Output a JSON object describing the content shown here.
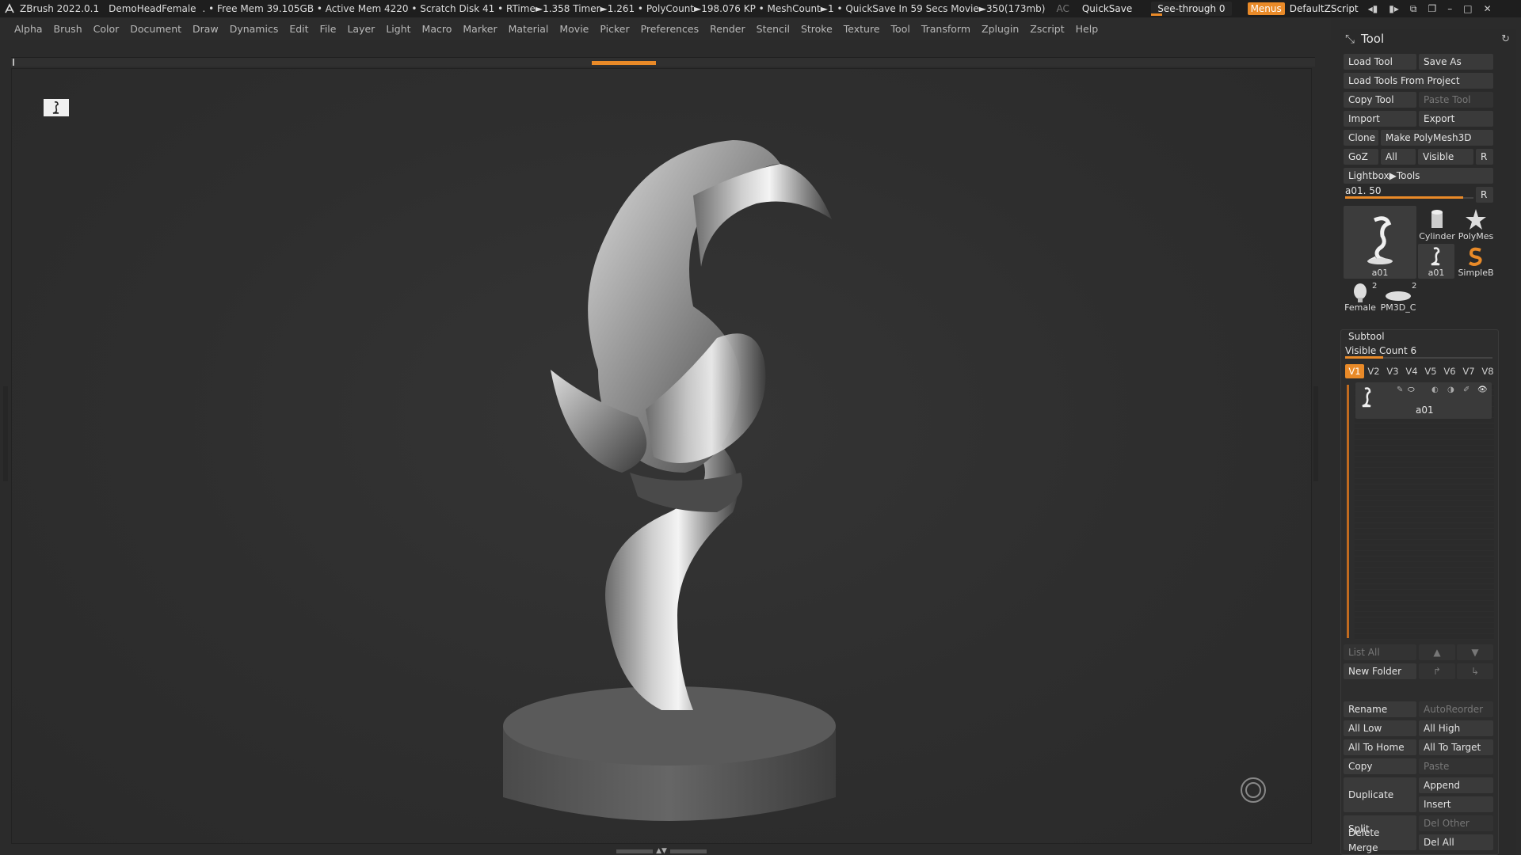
{
  "titlebar": {
    "app": "ZBrush 2022.0.1",
    "project": "DemoHeadFemale",
    "stats": ". • Free Mem 39.105GB • Active Mem 4220 • Scratch Disk 41 • RTime►1.358 Timer►1.261 • PolyCount►198.076 KP • MeshCount►1 • QuickSave In 59 Secs Movie►350(173mb)",
    "ac": "AC",
    "quicksave": "QuickSave",
    "seethrough": "See-through  0",
    "seethrough_value": 0,
    "menus": "Menus",
    "default_zscript": "DefaultZScript",
    "icons": [
      "prev-layout-icon",
      "next-layout-icon",
      "restore-icon",
      "window-icon",
      "minimize-icon",
      "maximize-icon",
      "close-icon"
    ]
  },
  "menubar": [
    "Alpha",
    "Brush",
    "Color",
    "Document",
    "Draw",
    "Dynamics",
    "Edit",
    "File",
    "Layer",
    "Light",
    "Macro",
    "Marker",
    "Material",
    "Movie",
    "Picker",
    "Preferences",
    "Render",
    "Stencil",
    "Stroke",
    "Texture",
    "Tool",
    "Transform",
    "Zplugin",
    "Zscript",
    "Help"
  ],
  "tool_panel": {
    "title": "Tool",
    "buttons": {
      "load_tool": "Load Tool",
      "save_as": "Save As",
      "load_from_project": "Load Tools From Project",
      "copy_tool": "Copy Tool",
      "paste_tool": "Paste Tool",
      "import": "Import",
      "export": "Export",
      "clone": "Clone",
      "make_polymesh": "Make PolyMesh3D",
      "goz": "GoZ",
      "all": "All",
      "visible": "Visible",
      "r": "R",
      "lightbox_tools": "Lightbox▶Tools"
    },
    "slider": {
      "label": "a01. 50",
      "r": "R",
      "fraction": 0.92
    },
    "thumbs": {
      "main": "a01",
      "cylinder": "Cylinder",
      "polymesh": "PolyMes",
      "a01_small": "a01",
      "simpleb": "SimpleB",
      "female": "Female",
      "female_count": "2",
      "pm3d": "PM3D_C",
      "pm3d_count": "2"
    }
  },
  "subtool_panel": {
    "title": "Subtool",
    "visible_count": "Visible Count 6",
    "visible_count_fraction": 0.26,
    "vtabs": [
      "V1",
      "V2",
      "V3",
      "V4",
      "V5",
      "V6",
      "V7",
      "V8"
    ],
    "item_name": "a01",
    "list_all": "List All",
    "new_folder": "New Folder",
    "rename": "Rename",
    "auto_reorder": "AutoReorder",
    "all_low": "All Low",
    "all_high": "All High",
    "all_to_home": "All To Home",
    "all_to_target": "All To Target",
    "copy": "Copy",
    "paste": "Paste",
    "duplicate": "Duplicate",
    "append": "Append",
    "insert": "Insert",
    "delete": "Delete",
    "del_other": "Del Other",
    "del_all": "Del All",
    "split": "Split",
    "merge": "Merge"
  },
  "colors": {
    "accent": "#e98a28",
    "background": "#2b2b2b",
    "panel": "#2a2a2a"
  }
}
